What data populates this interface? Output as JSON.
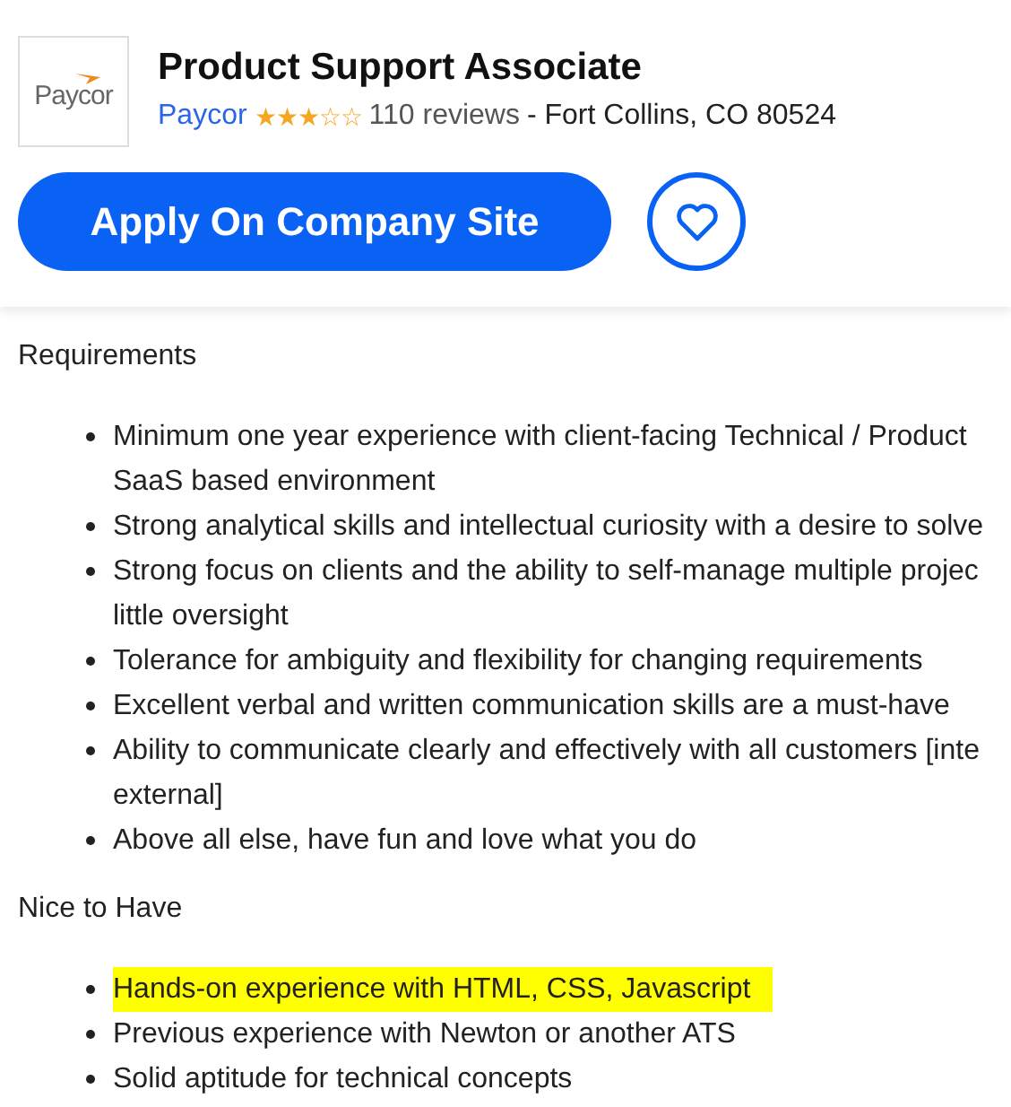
{
  "header": {
    "logo": "Paycor",
    "title": "Product Support Associate",
    "company": "Paycor",
    "stars": 3,
    "reviews": "110 reviews",
    "location": "- Fort Collins, CO 80524",
    "apply_button": "Apply On Company Site",
    "saved": false
  },
  "sections": [
    {
      "heading": "Requirements",
      "items": [
        {
          "lines": [
            "Minimum one year experience with client-facing Technical / Product",
            "SaaS based environment"
          ],
          "highlighted": false
        },
        {
          "lines": [
            "Strong analytical skills and intellectual curiosity with a desire to solve"
          ],
          "highlighted": false
        },
        {
          "lines": [
            "Strong focus on clients and the ability to self-manage multiple projec",
            "little oversight"
          ],
          "highlighted": false
        },
        {
          "lines": [
            "Tolerance for ambiguity and flexibility for changing requirements"
          ],
          "highlighted": false
        },
        {
          "lines": [
            "Excellent verbal and written communication skills are a must-have"
          ],
          "highlighted": false
        },
        {
          "lines": [
            "Ability to communicate clearly and effectively with all customers [inte",
            "external]"
          ],
          "highlighted": false
        },
        {
          "lines": [
            "Above all else, have fun and love what you do"
          ],
          "highlighted": false
        }
      ]
    },
    {
      "heading": "Nice to Have",
      "items": [
        {
          "lines": [
            "Hands-on experience with HTML, CSS, Javascript"
          ],
          "highlighted": true
        },
        {
          "lines": [
            "Previous experience with Newton or another ATS"
          ],
          "highlighted": false
        },
        {
          "lines": [
            "Solid aptitude for technical concepts"
          ],
          "highlighted": false
        }
      ]
    }
  ]
}
